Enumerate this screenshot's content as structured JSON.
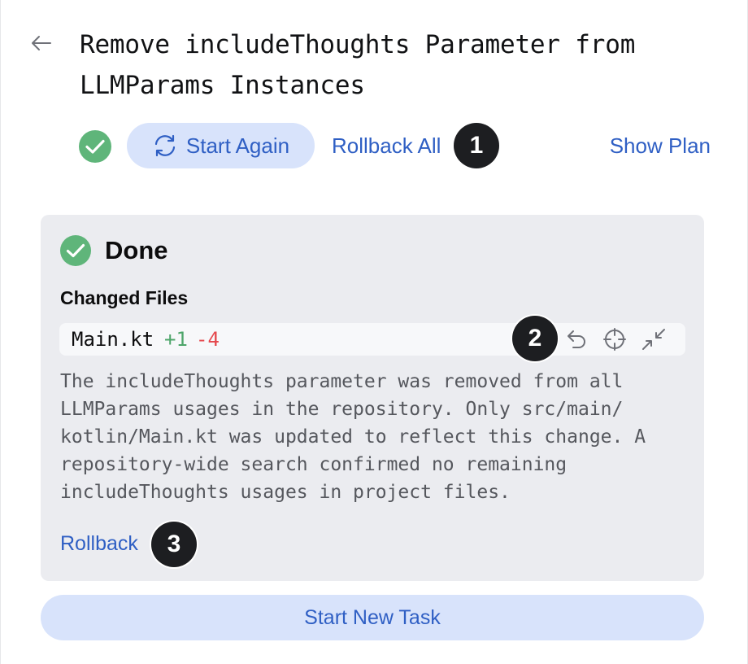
{
  "header": {
    "back_icon": "arrow-left-icon",
    "title": "Remove includeThoughts Parameter from LLMParams Instances"
  },
  "toolbar": {
    "status_icon": "check-circle-icon",
    "start_again_label": "Start Again",
    "start_again_icon": "refresh-icon",
    "rollback_all_label": "Rollback All",
    "show_plan_label": "Show Plan"
  },
  "markers": [
    "1",
    "2",
    "3"
  ],
  "task_card": {
    "status_icon": "check-circle-icon",
    "status_label": "Done",
    "changed_files_heading": "Changed Files",
    "files": [
      {
        "name": "Main.kt",
        "additions": "+1",
        "deletions": "-4",
        "actions": [
          "revert-icon",
          "locate-icon",
          "collapse-icon"
        ]
      }
    ],
    "summary_lines": [
      "The includeThoughts parameter was removed from all",
      "LLMParams usages in the repository. Only src/main/",
      "kotlin/Main.kt was updated to reflect this change. A",
      "repository-wide search confirmed no remaining",
      "includeThoughts usages in project files."
    ],
    "rollback_label": "Rollback"
  },
  "footer": {
    "start_new_task_label": "Start New Task"
  },
  "colors": {
    "accent": "#2f5fc4",
    "button_bg": "#d8e3fb",
    "success": "#5fb57a",
    "additions": "#4ea56a",
    "deletions": "#e5484d",
    "card_bg": "#ebecf0",
    "marker_bg": "#1d1e21"
  }
}
